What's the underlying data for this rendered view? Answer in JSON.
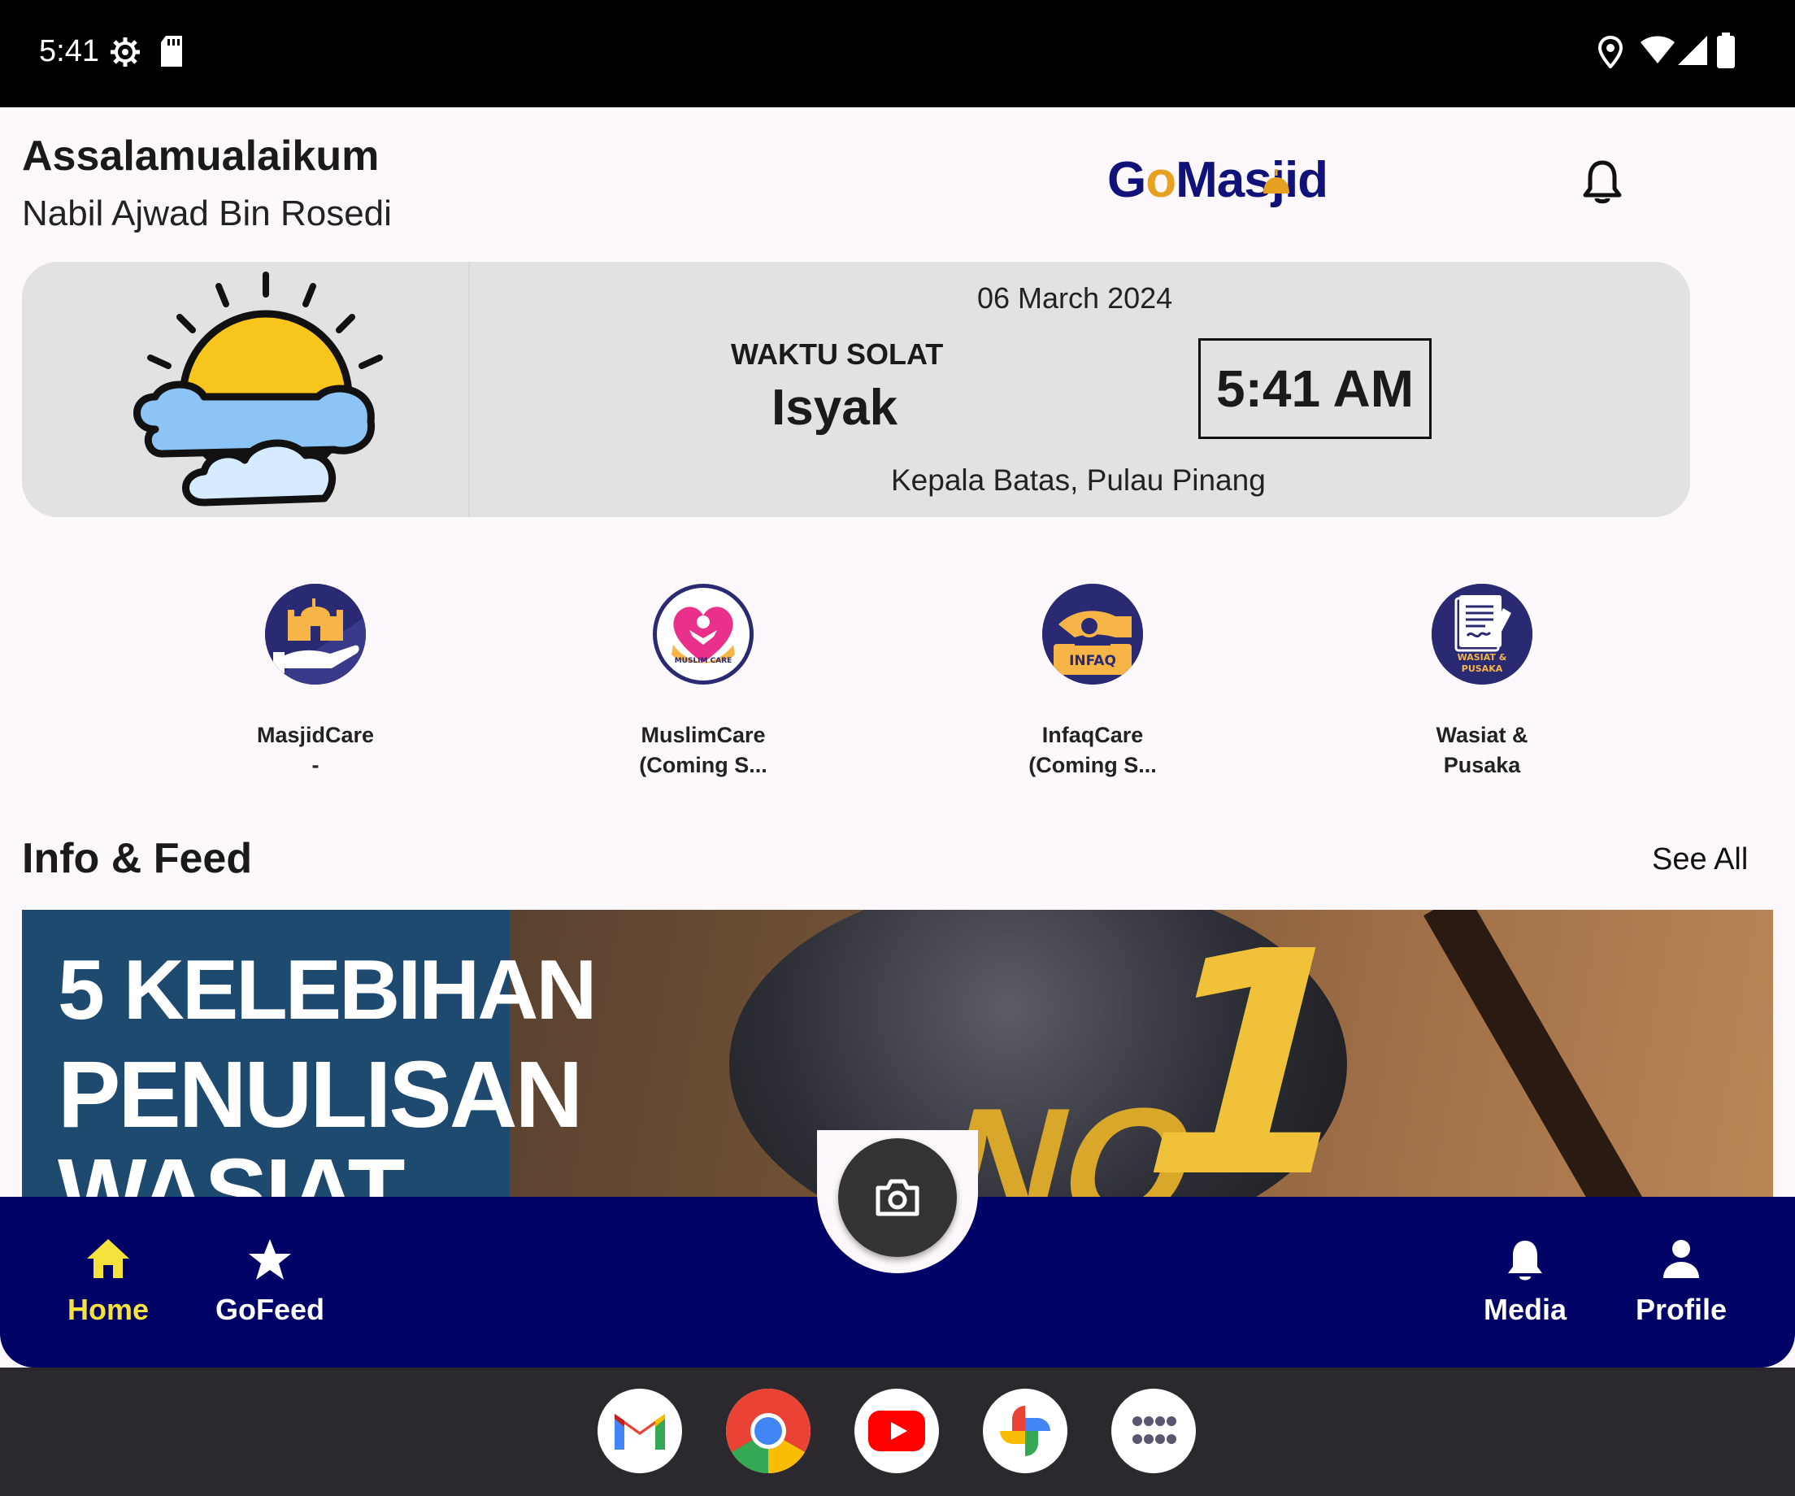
{
  "status_bar": {
    "time": "5:41",
    "icons": [
      "settings-icon",
      "sd-card-icon",
      "location-icon",
      "wifi-icon",
      "signal-icon",
      "battery-icon"
    ]
  },
  "header": {
    "greeting": "Assalamualaikum",
    "user_name": "Nabil Ajwad Bin Rosedi",
    "logo_text": "GoMasjid",
    "logo_prefix": "G",
    "logo_o": "o",
    "logo_suffix": "Masjid",
    "notification_icon": "bell-icon"
  },
  "prayer_card": {
    "date": "06 March 2024",
    "label": "WAKTU SOLAT",
    "prayer_name": "Isyak",
    "current_time": "5:41 AM",
    "location": "Kepala Batas, Pulau Pinang",
    "weather_icon": "sun-cloud-icon"
  },
  "services": [
    {
      "label": "MasjidCare\n-",
      "icon": "masjid-care-icon"
    },
    {
      "label": "MuslimCare\n(Coming S...",
      "icon": "muslim-care-icon"
    },
    {
      "label": "InfaqCare\n(Coming S...",
      "icon": "infaq-care-icon"
    },
    {
      "label": "Wasiat &\nPusaka",
      "icon": "wasiat-pusaka-icon"
    }
  ],
  "feed": {
    "title": "Info & Feed",
    "see_all": "See All",
    "banner": {
      "line1": "5 KELEBIHAN",
      "line2": "PENULISAN",
      "line3": "WASIAT",
      "badge": "1",
      "badge_prefix": "NO"
    }
  },
  "bottom_nav": {
    "items": [
      {
        "label": "Home",
        "icon": "home-icon",
        "active": true
      },
      {
        "label": "GoFeed",
        "icon": "star-icon",
        "active": false
      },
      {
        "label": "Media",
        "icon": "bell-icon",
        "active": false
      },
      {
        "label": "Profile",
        "icon": "person-icon",
        "active": false
      }
    ],
    "fab_icon": "camera-icon"
  },
  "dock": {
    "apps": [
      "gmail-icon",
      "chrome-icon",
      "youtube-icon",
      "photos-icon",
      "app-drawer-icon"
    ]
  },
  "colors": {
    "nav_bg": "#010466",
    "nav_active": "#f6e23c",
    "card_bg": "#e2e2e2",
    "logo_blue": "#10127a",
    "logo_gold": "#e8a020"
  }
}
